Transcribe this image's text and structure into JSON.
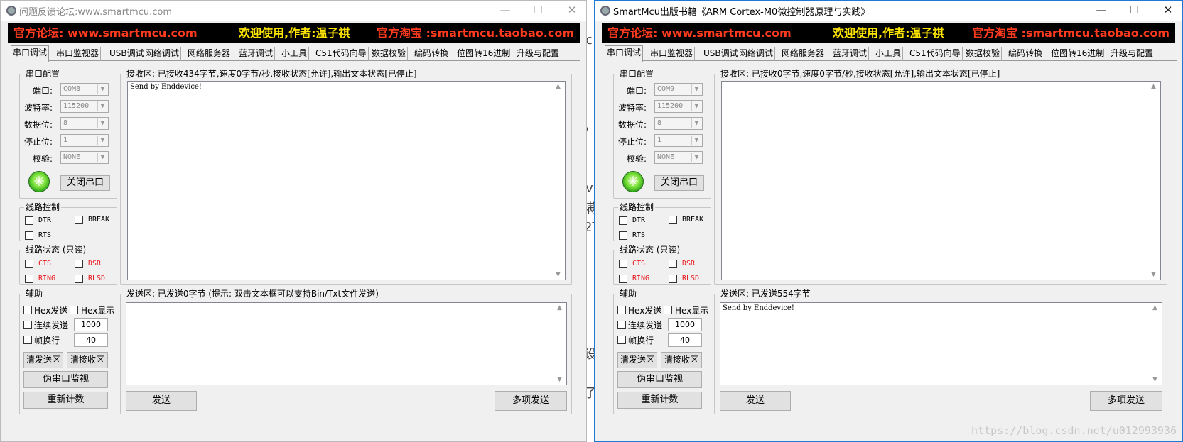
{
  "background": {
    "fragments": [
      "c",
      "ʹ",
      "v",
      "满",
      "2T",
      "设",
      "了",
      "↑"
    ]
  },
  "watermark": "https://blog.csdn.net/u012993936",
  "banner": {
    "left": "官方论坛: www.smartmcu.com",
    "center": "欢迎使用,作者:温子祺",
    "right": "官方淘宝 :smartmcu.taobao.com"
  },
  "tabs": [
    "串口调试",
    "串口监视器",
    "USB调试",
    "网络调试",
    "网络服务器",
    "蓝牙调试",
    "小工具",
    "C51代码向导",
    "数据校验",
    "编码转换",
    "位图转16进制",
    "升级与配置"
  ],
  "serial_config": {
    "title": "串口配置",
    "port_label": "端口:",
    "baud_label": "波特率:",
    "data_bits_label": "数据位:",
    "stop_bits_label": "停止位:",
    "parity_label": "校验:",
    "baud": "115200",
    "data_bits": "8",
    "stop_bits": "1",
    "parity": "NONE",
    "close_button": "关闭串口"
  },
  "line_control": {
    "title": "线路控制",
    "dtr": "DTR",
    "break": "BREAK",
    "rts": "RTS"
  },
  "line_status": {
    "title": "线路状态 (只读)",
    "cts": "CTS",
    "dsr": "DSR",
    "ring": "RING",
    "rlsd": "RLSD"
  },
  "assist": {
    "title": "辅助",
    "hex_send": "Hex发送",
    "hex_display": "Hex显示",
    "continuous_send": "连续发送",
    "continuous_interval": "1000",
    "frame_newline": "帧换行",
    "frame_value": "40",
    "clear_send": "清发送区",
    "clear_receive": "清接收区",
    "pseudo_monitor": "伪串口监视",
    "recount": "重新计数"
  },
  "buttons": {
    "send": "发送",
    "multi_send": "多项发送"
  },
  "windows": [
    {
      "title": "问题反馈论坛:www.smartmcu.com",
      "port": "COM8",
      "receive_label": "接收区: 已接收434字节,速度0字节/秒,接收状态[允许],输出文本状态[已停止]",
      "receive_text": "Send by Enddevice!",
      "send_label": "发送区: 已发送0字节 (提示: 双击文本框可以支持Bin/Txt文件发送)",
      "send_text": ""
    },
    {
      "title": "SmartMcu出版书籍《ARM Cortex-M0微控制器原理与实践》",
      "port": "COM9",
      "receive_label": "接收区: 已接收0字节,速度0字节/秒,接收状态[允许],输出文本状态[已停止]",
      "receive_text": "",
      "send_label": "发送区: 已发送554字节",
      "send_text": "Send by Enddevice!"
    }
  ],
  "window_controls": {
    "minimize": "—",
    "maximize": "☐",
    "close": "✕"
  }
}
